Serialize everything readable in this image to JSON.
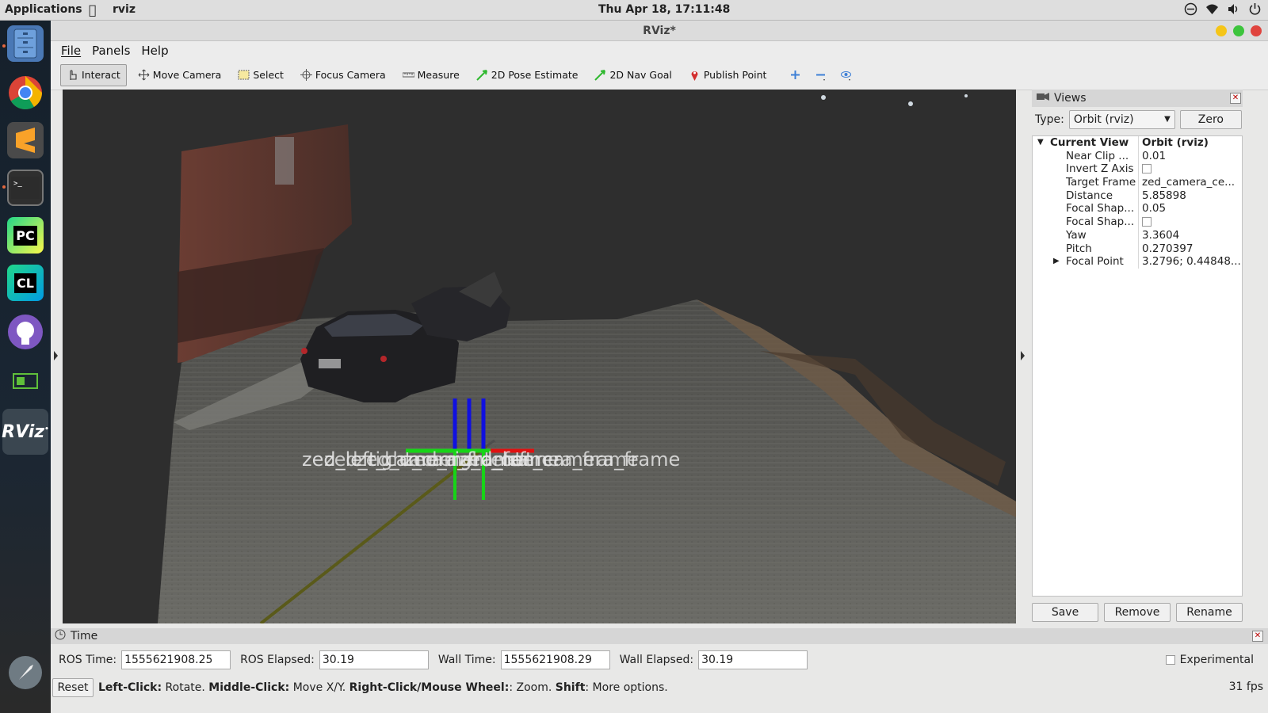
{
  "topbar": {
    "applications": "Applications",
    "app_name": "rviz",
    "clock": "Thu Apr 18, 17:11:48"
  },
  "window": {
    "title": "RViz*"
  },
  "menu": {
    "file": "File",
    "panels": "Panels",
    "help": "Help"
  },
  "toolbar": {
    "interact": "Interact",
    "move_camera": "Move Camera",
    "select": "Select",
    "focus_camera": "Focus Camera",
    "measure": "Measure",
    "pose_estimate": "2D Pose Estimate",
    "nav_goal": "2D Nav Goal",
    "publish_point": "Publish Point"
  },
  "scene": {
    "frame_label_a": "zed_left_camera_frame",
    "frame_label_b": "zed_right_camera_frame",
    "frame_label_c": "zed_camera_center"
  },
  "views": {
    "title": "Views",
    "type_label": "Type:",
    "type_value": "Orbit (rviz)",
    "zero_label": "Zero",
    "current_view_label": "Current View",
    "current_view_value": "Orbit (rviz)",
    "props": [
      {
        "name": "Near Clip ...",
        "value": "0.01"
      },
      {
        "name": "Invert Z Axis",
        "value": ""
      },
      {
        "name": "Target Frame",
        "value": "zed_camera_ce..."
      },
      {
        "name": "Distance",
        "value": "5.85898"
      },
      {
        "name": "Focal Shap...",
        "value": "0.05"
      },
      {
        "name": "Focal Shap...",
        "value": ""
      },
      {
        "name": "Yaw",
        "value": "3.3604"
      },
      {
        "name": "Pitch",
        "value": "0.270397"
      },
      {
        "name": "Focal Point",
        "value": "3.2796; 0.44848..."
      }
    ],
    "save": "Save",
    "remove": "Remove",
    "rename": "Rename"
  },
  "time": {
    "title": "Time",
    "ros_time_label": "ROS Time:",
    "ros_time": "1555621908.25",
    "ros_elapsed_label": "ROS Elapsed:",
    "ros_elapsed": "30.19",
    "wall_time_label": "Wall Time:",
    "wall_time": "1555621908.29",
    "wall_elapsed_label": "Wall Elapsed:",
    "wall_elapsed": "30.19",
    "experimental": "Experimental"
  },
  "status": {
    "reset": "Reset",
    "left_click": "Left-Click:",
    "left_click_action": " Rotate. ",
    "middle_click": "Middle-Click:",
    "middle_click_action": " Move X/Y. ",
    "right_click": "Right-Click/Mouse Wheel:",
    "right_click_action": ": Zoom. ",
    "shift": "Shift",
    "shift_action": ": More options.",
    "fps": "31 fps"
  },
  "dock": {
    "rviz_label": "RViz",
    "pc_label": "PC",
    "cl_label": "CL"
  }
}
